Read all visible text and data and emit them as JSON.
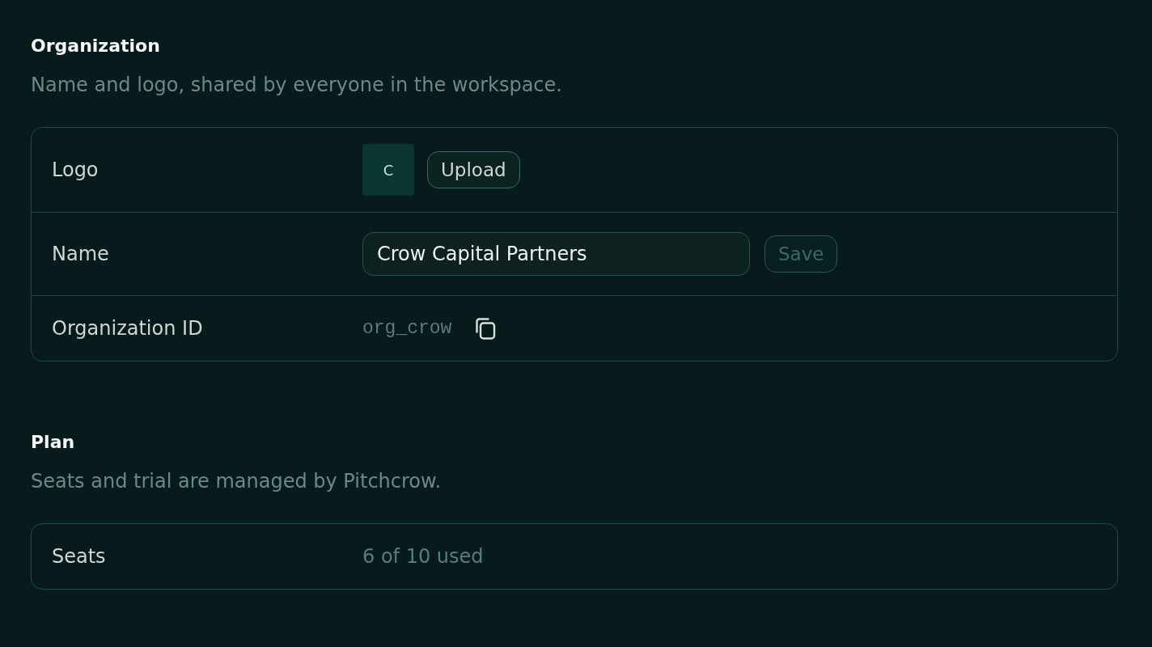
{
  "sections": [
    {
      "title": "Organization",
      "description": "Name and logo, shared by everyone in the workspace.",
      "rows": [
        {
          "kind": "logo",
          "label": "Logo",
          "initial": "C",
          "action": {
            "label": "Upload",
            "disabled": false
          }
        },
        {
          "kind": "input",
          "label": "Name",
          "value": "Crow Capital Partners",
          "action": {
            "label": "Save",
            "disabled": true
          }
        },
        {
          "kind": "code",
          "label": "Organization ID",
          "value": "org_crow"
        }
      ]
    },
    {
      "title": "Plan",
      "description": "Seats and trial are managed by Pitchcrow.",
      "rows": [
        {
          "kind": "text",
          "label": "Seats",
          "value": "6 of 10 used"
        }
      ]
    }
  ]
}
